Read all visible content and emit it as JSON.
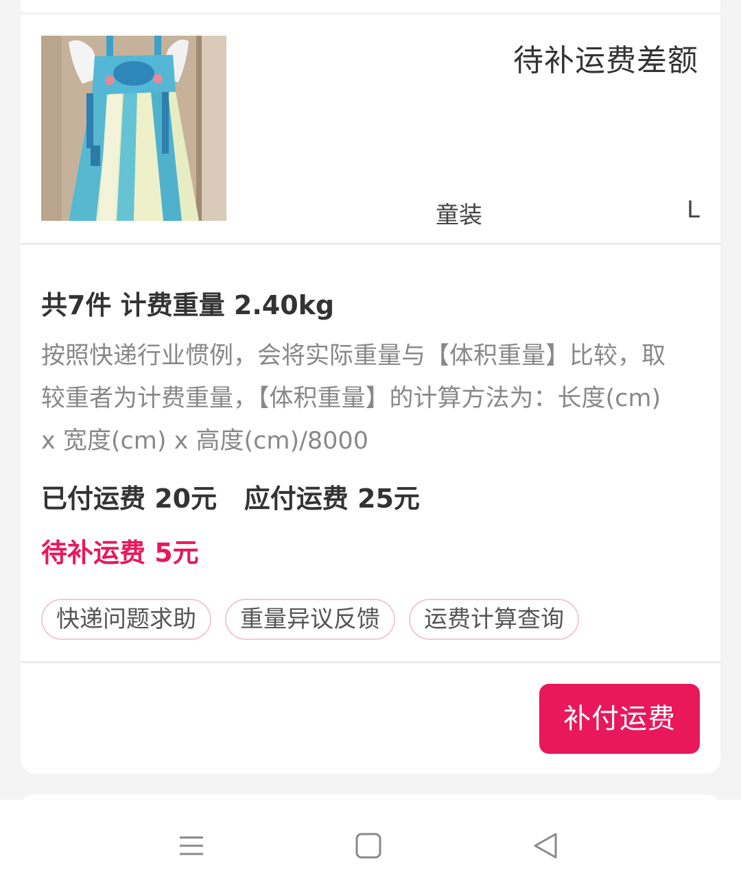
{
  "product": {
    "status_title": "待补运费差额",
    "category": "童装",
    "size": "L",
    "image_icon": "product-photo-dress"
  },
  "shipping": {
    "summary": "共7件 计费重量 2.40kg",
    "explanation": "按照快递行业惯例，会将实际重量与【体积重量】比较，取较重者为计费重量，【体积重量】的计算方法为：长度(cm) x 宽度(cm) x 高度(cm)/8000",
    "paid_and_due": "已付运费 20元   应付运费 25元",
    "pending": "待补运费 5元"
  },
  "tags": [
    {
      "label": "快递问题求助"
    },
    {
      "label": "重量异议反馈"
    },
    {
      "label": "运费计算查询"
    }
  ],
  "actions": {
    "pay_label": "补付运费"
  },
  "nav": {
    "menu_icon": "menu-icon",
    "home_icon": "home-icon",
    "back_icon": "back-icon"
  },
  "colors": {
    "accent": "#e8185a",
    "tag_border": "#f3c8d4",
    "background": "#f4f4f4",
    "muted_text": "#888888"
  }
}
